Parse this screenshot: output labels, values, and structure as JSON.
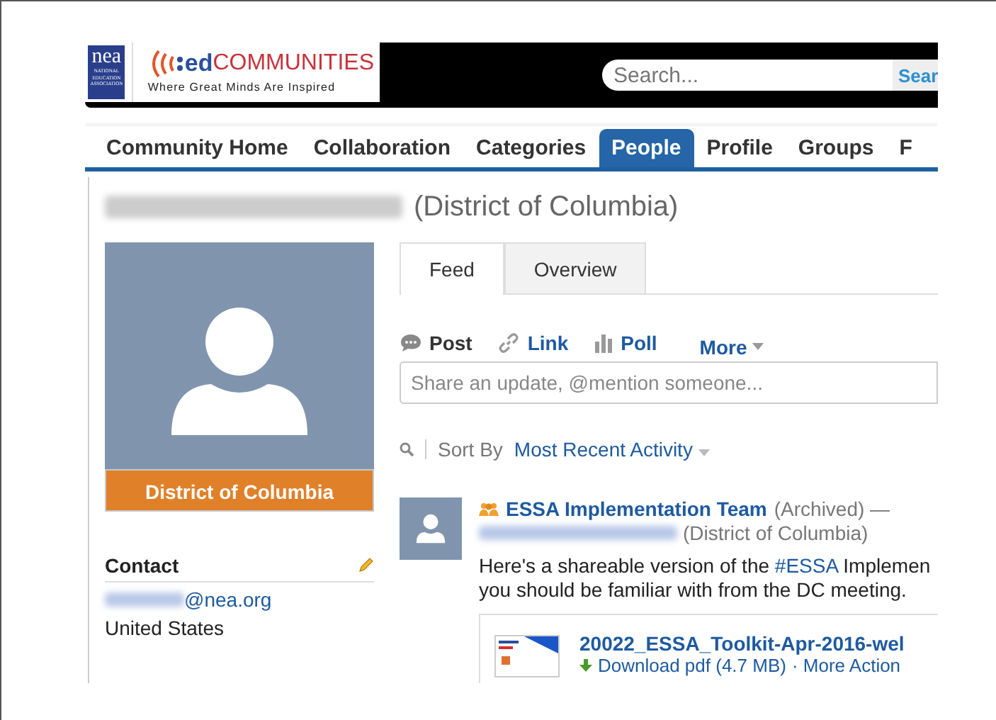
{
  "header": {
    "logo_org": "nea",
    "logo_org_sub": "NATIONAL EDUCATION ASSOCIATION",
    "logo_brand_ed": "ed",
    "logo_brand": "COMMUNITIES",
    "logo_tagline": "Where Great Minds Are Inspired",
    "search": {
      "placeholder": "Search..."
    },
    "search_button": "Sear"
  },
  "nav": [
    {
      "label": "Community Home",
      "selected": false
    },
    {
      "label": "Collaboration",
      "selected": false
    },
    {
      "label": "Categories",
      "selected": false
    },
    {
      "label": "People",
      "selected": true
    },
    {
      "label": "Profile",
      "selected": false
    },
    {
      "label": "Groups",
      "selected": false
    },
    {
      "label": "F",
      "selected": false
    }
  ],
  "profile": {
    "region": "(District of Columbia)",
    "badge": "District of Columbia",
    "contact_heading": "Contact",
    "email_domain": "@nea.org",
    "country": "United States"
  },
  "tabs": [
    {
      "label": "Feed",
      "selected": true
    },
    {
      "label": "Overview",
      "selected": false
    }
  ],
  "composer": {
    "actions": [
      {
        "label": "Post",
        "kind": "post",
        "selected": true
      },
      {
        "label": "Link",
        "kind": "link",
        "selected": false
      },
      {
        "label": "Poll",
        "kind": "poll",
        "selected": false
      }
    ],
    "more": "More",
    "placeholder": "Share an update, @mention someone..."
  },
  "sort": {
    "label": "Sort By",
    "value": "Most Recent Activity"
  },
  "post": {
    "group": "ESSA Implementation Team",
    "status": "(Archived) —",
    "author_region": "(District of Columbia)",
    "text_before": "Here's a shareable version of the ",
    "hashtag": "#ESSA",
    "text_after": " Implemen",
    "text_line2": "you should be familiar with from the DC meeting.",
    "file_name": "20022_ESSA_Toolkit-Apr-2016-wel",
    "download": "Download pdf (4.7 MB)",
    "more_actions": "· More Action"
  }
}
